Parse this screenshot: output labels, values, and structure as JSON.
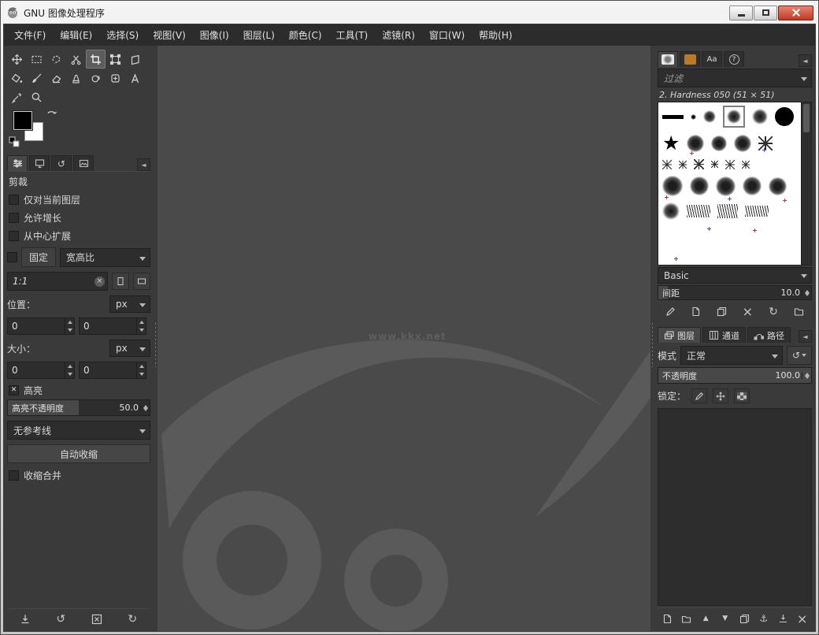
{
  "window": {
    "title": "GNU 图像处理程序"
  },
  "menubar": {
    "items": [
      "文件(F)",
      "编辑(E)",
      "选择(S)",
      "视图(V)",
      "图像(I)",
      "图层(L)",
      "颜色(C)",
      "工具(T)",
      "滤镜(R)",
      "窗口(W)",
      "帮助(H)"
    ]
  },
  "toolbox": {
    "tools": [
      "move",
      "rectangle-select",
      "free-select",
      "scissors-select",
      "crop",
      "unified-transform",
      "perspective",
      "bucket-fill",
      "paintbrush",
      "eraser",
      "clone",
      "smudge",
      "heal",
      "text",
      "color-picker",
      "zoom"
    ],
    "active_tool": "crop",
    "foreground": "#000000",
    "background": "#ffffff"
  },
  "tool_options": {
    "title": "剪裁",
    "current_layer_only": "仅对当前图层",
    "allow_growing": "允许增长",
    "expand_from_center": "从中心扩展",
    "fixed_label": "固定",
    "fixed_combo": "宽高比",
    "ratio_value": "1:1",
    "position_label": "位置：",
    "position_unit": "px",
    "position_x": "0",
    "position_y": "0",
    "size_label": "大小：",
    "size_unit": "px",
    "size_w": "0",
    "size_h": "0",
    "highlight_label": "高亮",
    "highlight_opacity_label": "高亮不透明度",
    "highlight_opacity_value": "50.0",
    "guides_value": "无参考线",
    "auto_shrink_label": "自动收缩",
    "shrink_merged_label": "收缩合并"
  },
  "brushes": {
    "filter_placeholder": "过滤",
    "selected_brush": "2. Hardness 050 (51 × 51)",
    "collection": "Basic",
    "spacing_label": "间距",
    "spacing_value": "10.0"
  },
  "layers": {
    "tabs": [
      "图层",
      "通道",
      "路径"
    ],
    "mode_label": "模式",
    "mode_value": "正常",
    "opacity_label": "不透明度",
    "opacity_value": "100.0",
    "lock_label": "锁定："
  },
  "canvas": {
    "watermark": "www.kkx.net"
  },
  "glyphs": {
    "check": "✕",
    "clear": "×",
    "undo": "↺",
    "redo": "↻",
    "up": "▲",
    "down": "▼",
    "dock_menu": "◄",
    "anchor": "⚓",
    "star": "★",
    "fonts_tab": "Aa",
    "help_tab": "?"
  },
  "colors": {
    "close_button": "#c03a26",
    "patterns_tab": "#b97a2a",
    "canvas": "#4a4a4a",
    "panel": "#3a3a3a"
  }
}
